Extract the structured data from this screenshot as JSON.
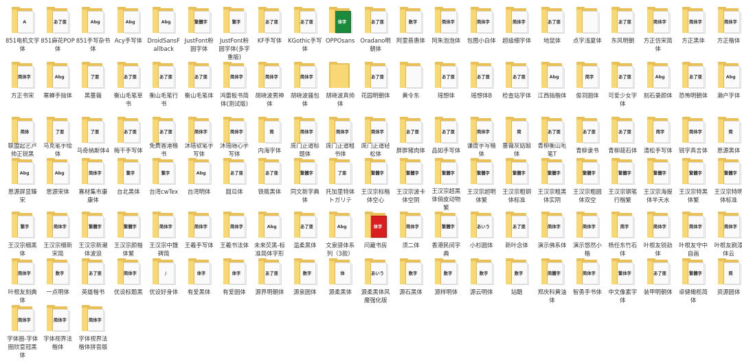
{
  "colors": {
    "folder": "#e9bf57",
    "folder_front": "#f8d775",
    "label": "#333333"
  },
  "items": [
    {
      "name": "851电机文字体",
      "preview": "A"
    },
    {
      "name": "851麻花POP体",
      "preview": "あ了亜"
    },
    {
      "name": "851手写杂书体",
      "preview": "Abg"
    },
    {
      "name": "Acy手写体",
      "preview": "Abg"
    },
    {
      "name": "DroidSansFallback",
      "preview": "Abg"
    },
    {
      "name": "JustFont粉圆字体",
      "preview": "繁體字"
    },
    {
      "name": "JustFont粉圆字体(多字重版)",
      "preview": "繁字"
    },
    {
      "name": "KF手写体",
      "preview": "あ了亜"
    },
    {
      "name": "KGothic手写体",
      "preview": "あ了亜"
    },
    {
      "name": "OPPOsans",
      "preview": "体字",
      "kind": "green"
    },
    {
      "name": "Oradano明朝体",
      "preview": "あ了亜"
    },
    {
      "name": "阿里普惠体",
      "preview": "数字"
    },
    {
      "name": "阿朱泡泡体",
      "preview": "简体字"
    },
    {
      "name": "包图小白体",
      "preview": "简体字"
    },
    {
      "name": "超级细字体",
      "preview": "简体字"
    },
    {
      "name": "地鼠体",
      "preview": "あ了亜"
    },
    {
      "name": "点字浅夏体",
      "preview": ""
    },
    {
      "name": "东风明朝",
      "preview": "あ了亜"
    },
    {
      "name": "方正仿宋简体",
      "preview": "简体字"
    },
    {
      "name": "方正黑体",
      "preview": "简体字"
    },
    {
      "name": "方正楷体",
      "preview": "简体字"
    },
    {
      "name": "方正书宋",
      "preview": "简体字"
    },
    {
      "name": "寒蝉手拙体",
      "preview": "Abg"
    },
    {
      "name": "黑蔷薇",
      "preview": "了亜"
    },
    {
      "name": "衡山毛笔草书",
      "preview": "あ了亜"
    },
    {
      "name": "衡山毛笔行书",
      "preview": "あ了亜"
    },
    {
      "name": "衡山毛笔体",
      "preview": "あ了亜"
    },
    {
      "name": "鸿蕾板书简体(测试版)",
      "preview": "简体字"
    },
    {
      "name": "胡晓波男神体",
      "preview": "简体字"
    },
    {
      "name": "胡晓波骚包体",
      "preview": "简体字"
    },
    {
      "name": "胡晓波真帅体",
      "preview": "",
      "kind": "plain"
    },
    {
      "name": "花园明朝体",
      "preview": "あ了亜"
    },
    {
      "name": "黄令东",
      "preview": ""
    },
    {
      "name": "瑶想体",
      "preview": "あ了亜"
    },
    {
      "name": "瑶想体B",
      "preview": "あ了亜"
    },
    {
      "name": "检查站字体",
      "preview": "あ了亜"
    },
    {
      "name": "江西拙楷体",
      "preview": "Abg"
    },
    {
      "name": "俊羽圆体",
      "preview": "简字"
    },
    {
      "name": "可爱少女字体",
      "preview": "あ了亜"
    },
    {
      "name": "刻石录颜体",
      "preview": "Abg"
    },
    {
      "name": "恐怖明朝体",
      "preview": "あ了亜"
    },
    {
      "name": "濑户字体",
      "preview": "Abg"
    },
    {
      "name": "联盟起艺卢帅正锐黑",
      "preview": "简体"
    },
    {
      "name": "马克笔手绘体",
      "preview": "了亜"
    },
    {
      "name": "马奇纳斯体4",
      "preview": "了亜"
    },
    {
      "name": "梅干手写体",
      "preview": "あ了亜"
    },
    {
      "name": "免费香港楷书",
      "preview": "あ了亜"
    },
    {
      "name": "沐瑶软笔手写体",
      "preview": "简体字"
    },
    {
      "name": "沐瑶随心手写体",
      "preview": "简体字"
    },
    {
      "name": "内海字体",
      "preview": "简"
    },
    {
      "name": "庞门正道标题体",
      "preview": "简体字"
    },
    {
      "name": "庞门正道粗书体",
      "preview": "简体字"
    },
    {
      "name": "庞门正道轻松体",
      "preview": "简体字"
    },
    {
      "name": "胖胖猪肉体",
      "preview": "あ了亜"
    },
    {
      "name": "品如手写体",
      "preview": "あ了亜"
    },
    {
      "name": "谦度手写楷体",
      "preview": "简体字"
    },
    {
      "name": "蔷薇灰姑娘体",
      "preview": "简"
    },
    {
      "name": "青柳衡山毛笔T",
      "preview": "あ了亜"
    },
    {
      "name": "青柳隶书",
      "preview": "あ了亜"
    },
    {
      "name": "青柳疏石体",
      "preview": "あ了亜"
    },
    {
      "name": "清松手写体",
      "preview": "简字"
    },
    {
      "name": "锐字真言体",
      "preview": "简体字"
    },
    {
      "name": "思源黑体",
      "preview": "简"
    },
    {
      "name": "思源屏显臻宋",
      "preview": "Abg"
    },
    {
      "name": "思源宋体",
      "preview": "Abg"
    },
    {
      "name": "寡材集市康康体",
      "preview": "简体字"
    },
    {
      "name": "台北黑体",
      "preview": "繁字"
    },
    {
      "name": "台湾cwTex",
      "preview": "繁字"
    },
    {
      "name": "台湾明体",
      "preview": "Abg"
    },
    {
      "name": "甜瓜体",
      "preview": "あ了亜"
    },
    {
      "name": "铁瓶黑体",
      "preview": "あ了亜"
    },
    {
      "name": "同文新字典体",
      "preview": "繁體字"
    },
    {
      "name": "托加里特体トガリテ",
      "preview": "了亜"
    },
    {
      "name": "王汉宗标楷体空心",
      "preview": "繁體字"
    },
    {
      "name": "王汉宗波卡体空阴",
      "preview": "繁體字"
    },
    {
      "name": "王汉宗超黑体俏皮动物繁",
      "preview": "繁體字"
    },
    {
      "name": "王汉宗超明体繁",
      "preview": "繁體字"
    },
    {
      "name": "王汉宗粗钢体标准",
      "preview": "繁體字"
    },
    {
      "name": "王汉宗粗黑体实阴",
      "preview": "繁體字"
    },
    {
      "name": "王汉宗粗圆体双空",
      "preview": "繁體字"
    },
    {
      "name": "王汉宗钢笔行楷繁",
      "preview": "繁體字"
    },
    {
      "name": "王汉宗海报体半天水",
      "preview": "繁體字"
    },
    {
      "name": "王汉宗特黑体繁",
      "preview": "繁體字"
    },
    {
      "name": "王汉宗特明体标准",
      "preview": "繁體字"
    },
    {
      "name": "王汉宗细黑体",
      "preview": "繁字"
    },
    {
      "name": "王汉宗细新宋简",
      "preview": "简体字"
    },
    {
      "name": "王汉宗新潮体波浪",
      "preview": "繁體字"
    },
    {
      "name": "王汉宗颜楷体繁",
      "preview": "繁體字"
    },
    {
      "name": "王汉宗中魏碑简",
      "preview": "简体字"
    },
    {
      "name": "王羲手写体",
      "preview": "简体字"
    },
    {
      "name": "王羲书法体",
      "preview": "简体字"
    },
    {
      "name": "未来荧黑-标准简体字形",
      "preview": "Abg"
    },
    {
      "name": "温柔黑体",
      "preview": "あ了亜"
    },
    {
      "name": "文泉驿体系列（3款）",
      "preview": "Abg"
    },
    {
      "name": "问藏书房",
      "preview": "体字",
      "kind": "red"
    },
    {
      "name": "须二体",
      "preview": "简体字"
    },
    {
      "name": "香港民间字典",
      "preview": "繁體字"
    },
    {
      "name": "小杉圆体",
      "preview": "あいう"
    },
    {
      "name": "新叶念体",
      "preview": "あ了亜"
    },
    {
      "name": "演示佛系体",
      "preview": "简体字"
    },
    {
      "name": "演示悠然小楷",
      "preview": "简体字"
    },
    {
      "name": "杨任东竹石体",
      "preview": "简字"
    },
    {
      "name": "叶根友锐劲体",
      "preview": "简体字"
    },
    {
      "name": "叶根友守中自画",
      "preview": "简体字"
    },
    {
      "name": "叶根友刷漆体云",
      "preview": "简体字"
    },
    {
      "name": "叶根友刻典体",
      "preview": "简体字"
    },
    {
      "name": "一点明体",
      "preview": "数字"
    },
    {
      "name": "英雄楷书",
      "preview": "あ了亜"
    },
    {
      "name": "优设标题黑",
      "preview": "简体字"
    },
    {
      "name": "优设好身体",
      "preview": "/"
    },
    {
      "name": "有爱黑体",
      "preview": "体字"
    },
    {
      "name": "有爱圆体",
      "preview": "体字"
    },
    {
      "name": "源界明朝体",
      "preview": "あ了亜"
    },
    {
      "name": "源泉圆体",
      "preview": "数字"
    },
    {
      "name": "源柔黑体",
      "preview": "体"
    },
    {
      "name": "源柔黑体风魔强化版",
      "preview": "あいう"
    },
    {
      "name": "源石黑体",
      "preview": "数字"
    },
    {
      "name": "源样明体",
      "preview": "数字"
    },
    {
      "name": "源云明体",
      "preview": "数字"
    },
    {
      "name": "站酷",
      "preview": "数字"
    },
    {
      "name": "郑庆科黄油体",
      "preview": "简體字"
    },
    {
      "name": "智勇手书体",
      "preview": "简体字"
    },
    {
      "name": "中文像素字体",
      "preview": "繁体字"
    },
    {
      "name": "装甲明朝体",
      "preview": "あ了亜"
    },
    {
      "name": "卓健橄榄简体",
      "preview": "繁體字"
    },
    {
      "name": "资源圆体",
      "preview": "简"
    },
    {
      "name": "字体圈-字体圈欣意冠黑体",
      "preview": "简体字"
    },
    {
      "name": "字体视界法楷体",
      "preview": "简体字"
    },
    {
      "name": "字体视界法楷体拼音版",
      "preview": "简体字"
    }
  ]
}
